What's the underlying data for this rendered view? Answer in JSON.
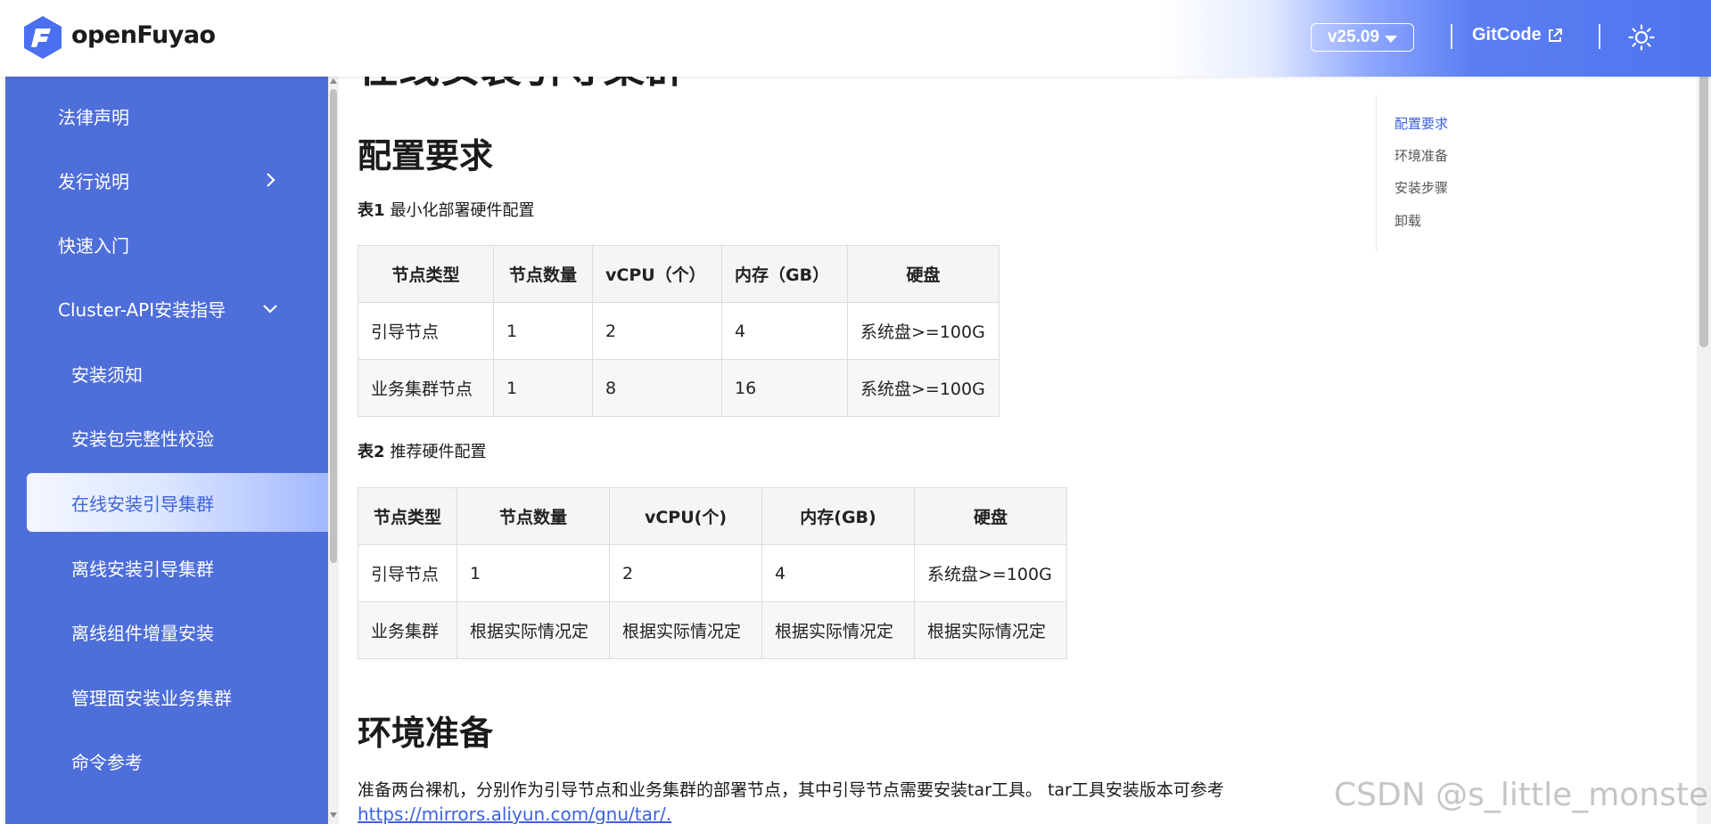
{
  "header": {
    "brand": "openFuyao",
    "version": "v25.09",
    "separator": "|",
    "gitcode_label": "GitCode",
    "icons": {
      "logo": "openfuyao-logo",
      "external": "external-link-icon",
      "theme": "sun-icon",
      "version_caret": "caret-down-icon"
    },
    "colors": {
      "accent": "#4f74ee",
      "sidebar": "#4e6ed9",
      "link": "#3e63dd"
    }
  },
  "sidebar": {
    "items": [
      {
        "label": "法律声明",
        "indent": false,
        "chevron": ""
      },
      {
        "label": "发行说明",
        "indent": false,
        "chevron": "right"
      },
      {
        "label": "快速入门",
        "indent": false,
        "chevron": ""
      },
      {
        "label": "Cluster-API安装指导",
        "indent": false,
        "chevron": "down"
      },
      {
        "label": "安装须知",
        "indent": true,
        "chevron": ""
      },
      {
        "label": "安装包完整性校验",
        "indent": true,
        "chevron": ""
      },
      {
        "label": "在线安装引导集群",
        "indent": true,
        "chevron": "",
        "active": true
      },
      {
        "label": "离线安装引导集群",
        "indent": true,
        "chevron": ""
      },
      {
        "label": "离线组件增量安装",
        "indent": true,
        "chevron": ""
      },
      {
        "label": "管理面安装业务集群",
        "indent": true,
        "chevron": ""
      },
      {
        "label": "命令参考",
        "indent": true,
        "chevron": ""
      }
    ]
  },
  "content": {
    "page_title": "在线安装引导集群",
    "section1_title": "配置要求",
    "table1": {
      "caption_label": "表1",
      "caption_text": "最小化部署硬件配置",
      "headers": [
        "节点类型",
        "节点数量",
        "vCPU（个）",
        "内存（GB）",
        "硬盘"
      ],
      "rows": [
        [
          "引导节点",
          "1",
          "2",
          "4",
          "系统盘>=100G"
        ],
        [
          "业务集群节点",
          "1",
          "8",
          "16",
          "系统盘>=100G"
        ]
      ]
    },
    "table2": {
      "caption_label": "表2",
      "caption_text": "推荐硬件配置",
      "headers": [
        "节点类型",
        "节点数量",
        "vCPU(个)",
        "内存(GB)",
        "硬盘"
      ],
      "rows": [
        [
          "引导节点",
          "1",
          "2",
          "4",
          "系统盘>=100G"
        ],
        [
          "业务集群",
          "根据实际情况定",
          "根据实际情况定",
          "根据实际情况定",
          "根据实际情况定"
        ]
      ]
    },
    "section2_title": "环境准备",
    "paragraph": "准备两台裸机，分别作为引导节点和业务集群的部署节点，其中引导节点需要安装tar工具。 tar工具安装版本可参考",
    "link": "https://mirrors.aliyun.com/gnu/tar/."
  },
  "toc": {
    "items": [
      "配置要求",
      "环境准备",
      "安装步骤",
      "卸载"
    ],
    "active_index": 0
  },
  "watermark": "CSDN @s_little_monster_"
}
